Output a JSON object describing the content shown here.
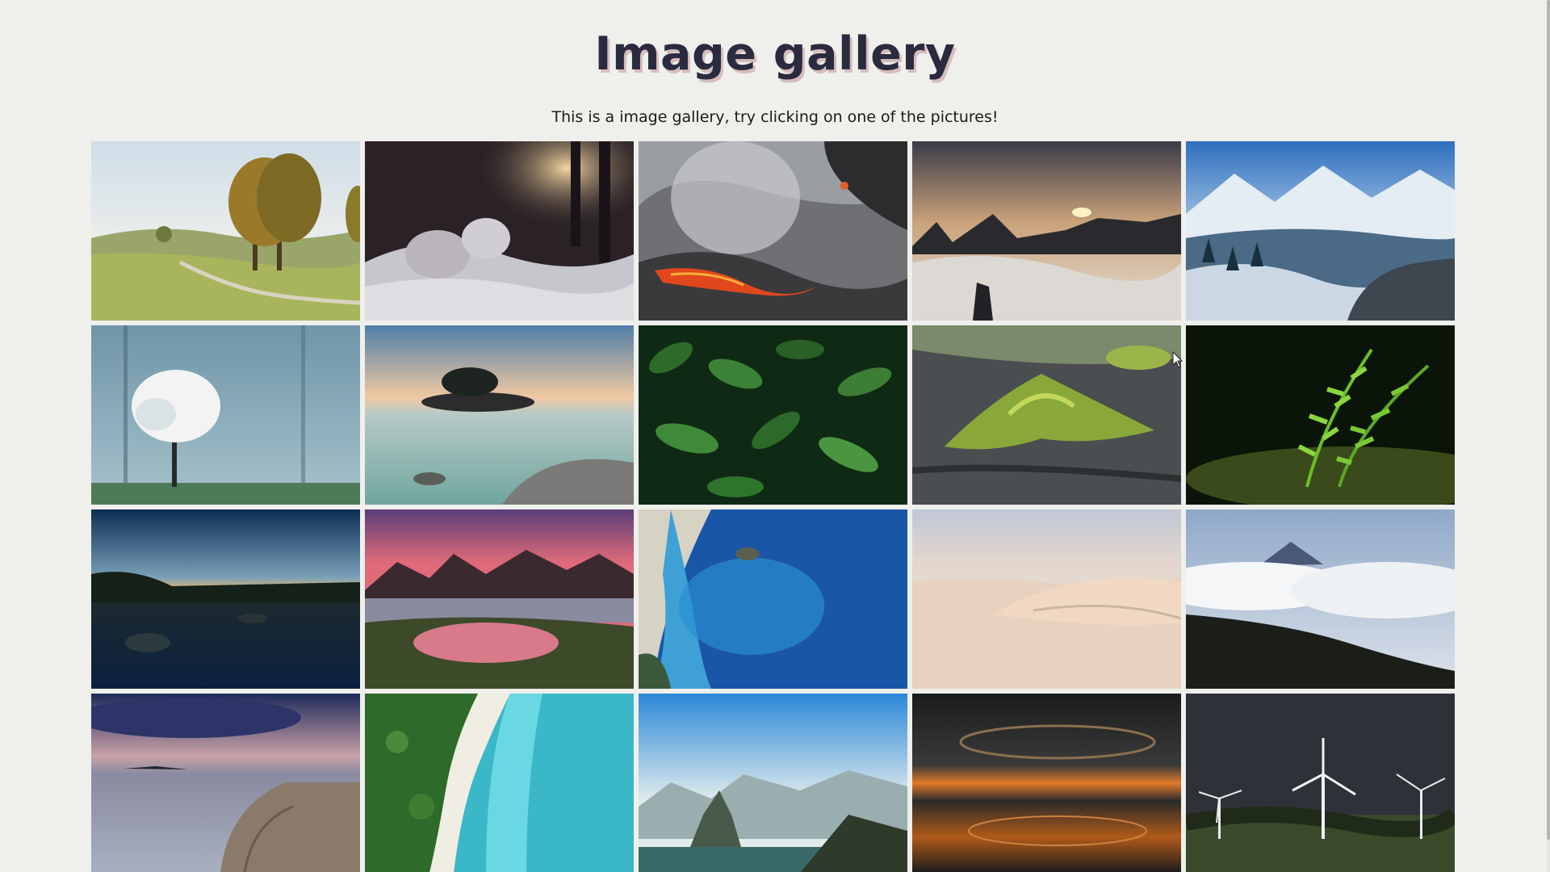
{
  "header": {
    "title": "Image gallery",
    "subtitle": "This is a image gallery, try clicking on one of the pictures!"
  },
  "colors": {
    "background": "#efefec",
    "title": "#2b2b40",
    "title_shadow": "#be9696"
  },
  "gallery": {
    "images": [
      {
        "name": "autumn-trees-meadow",
        "subject": "autumn trees by a country path"
      },
      {
        "name": "snowy-forest-sunset",
        "subject": "snowy forest with sun through trees"
      },
      {
        "name": "lava-ocean",
        "subject": "lava flowing into the ocean"
      },
      {
        "name": "mountain-peaks-clouds",
        "subject": "rock peaks above clouds at sunset"
      },
      {
        "name": "snowy-mountain-road",
        "subject": "snowy mountain road"
      },
      {
        "name": "misty-blossom-tree",
        "subject": "white blossom tree in fog"
      },
      {
        "name": "rocky-islet-sea",
        "subject": "rocky islet with trees at dusk"
      },
      {
        "name": "green-jungle-leaves",
        "subject": "dense green jungle foliage"
      },
      {
        "name": "green-volcanic-hills",
        "subject": "green mossy volcanic hills"
      },
      {
        "name": "fern-sprout",
        "subject": "green fern sprout"
      },
      {
        "name": "lake-twilight-reflection",
        "subject": "calm lake at twilight"
      },
      {
        "name": "pink-sky-mountains-lake",
        "subject": "mountains with pink sky over lake"
      },
      {
        "name": "blue-coast-aerial",
        "subject": "aerial view of blue sea coast"
      },
      {
        "name": "white-sand-dunes",
        "subject": "white sand dunes"
      },
      {
        "name": "mountain-above-clouds",
        "subject": "mountain above sea of clouds"
      },
      {
        "name": "rocky-shore-dusk",
        "subject": "rocky shore under stormy dusk sky"
      },
      {
        "name": "turquoise-beach-aerial",
        "subject": "aerial turquoise beach with forest"
      },
      {
        "name": "rio-mountains",
        "subject": "coastal mountains over bay"
      },
      {
        "name": "sunset-cloud-reflection",
        "subject": "dramatic sunset clouds reflected"
      },
      {
        "name": "wind-turbines-storm",
        "subject": "wind turbines under dark sky"
      }
    ]
  }
}
